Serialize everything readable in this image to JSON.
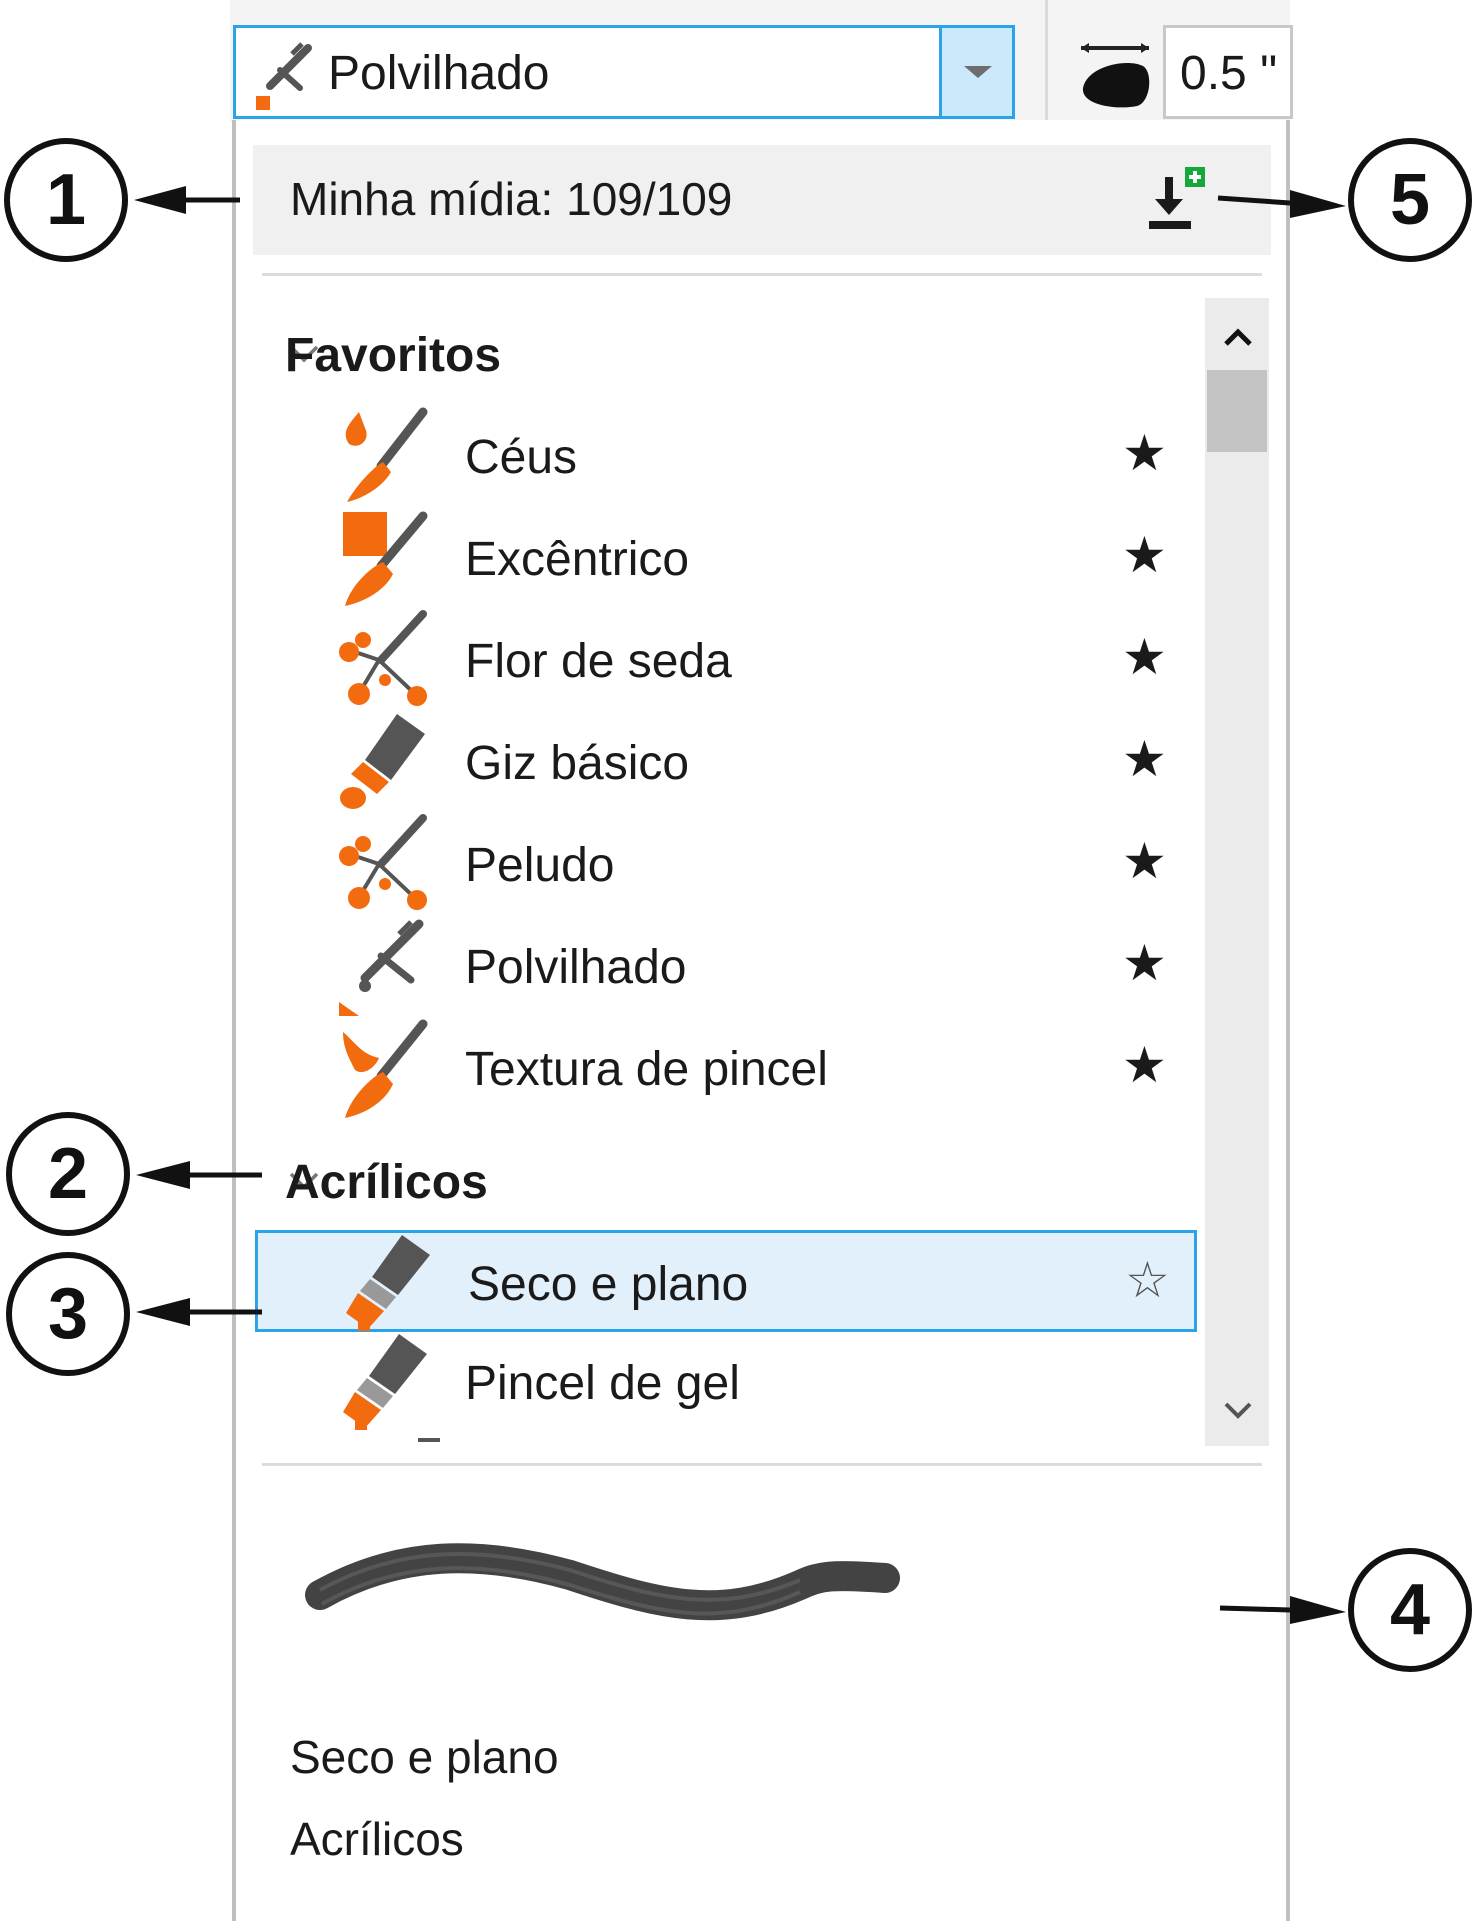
{
  "toolbar": {
    "brush_selector_value": "Polvilhado",
    "nib_size_value": "0.5 \""
  },
  "panel": {
    "media_label": "Minha mídia: 109/109",
    "groups": [
      {
        "label": "Favoritos",
        "items": [
          {
            "label": "Céus",
            "favorite": true,
            "star": "★",
            "icon": "water-drop-brush-icon"
          },
          {
            "label": "Excêntrico",
            "favorite": true,
            "star": "★",
            "icon": "shape-brush-icon"
          },
          {
            "label": "Flor de seda",
            "favorite": true,
            "star": "★",
            "icon": "particle-brush-icon"
          },
          {
            "label": "Giz básico",
            "favorite": true,
            "star": "★",
            "icon": "chalk-brush-icon"
          },
          {
            "label": "Peludo",
            "favorite": true,
            "star": "★",
            "icon": "particle-brush-icon"
          },
          {
            "label": "Polvilhado",
            "favorite": true,
            "star": "★",
            "icon": "sprinkle-brush-icon"
          },
          {
            "label": "Textura de pincel",
            "favorite": true,
            "star": "★",
            "icon": "texture-brush-icon"
          }
        ]
      },
      {
        "label": "Acrílicos",
        "items": [
          {
            "label": "Seco e plano",
            "favorite": false,
            "selected": true,
            "star": "☆",
            "icon": "flat-brush-icon"
          },
          {
            "label": "Pincel de gel",
            "favorite": false,
            "star": "",
            "icon": "flat-brush-icon"
          }
        ]
      }
    ],
    "preview": {
      "brush_name": "Seco e plano",
      "category": "Acrílicos"
    }
  },
  "callouts": [
    "1",
    "2",
    "3",
    "4",
    "5"
  ],
  "colors": {
    "accent": "#2aa3e8",
    "icon_orange": "#f26b0f",
    "icon_gray": "#555555",
    "selection_bg": "#e2f0fc"
  }
}
